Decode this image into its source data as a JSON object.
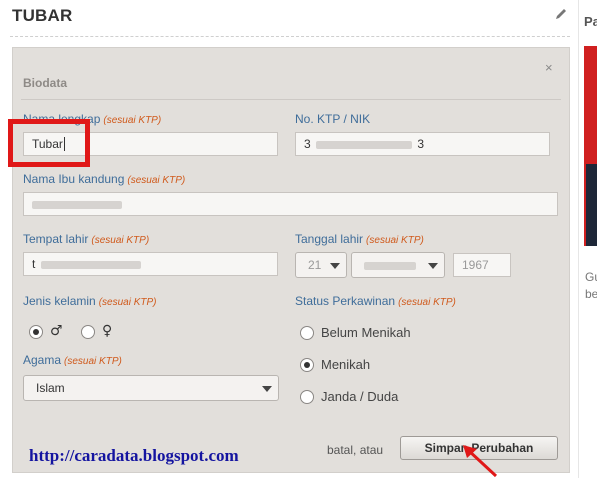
{
  "page": {
    "title": "TUBAR"
  },
  "sidebar": {
    "title": "Pa",
    "caption_line1": "Gu",
    "caption_line2": "be"
  },
  "form": {
    "section_title": "Biodata",
    "close_label": "×",
    "hint": "(sesuai KTP)",
    "full_name": {
      "label": "Nama lengkap",
      "value": "Tubar"
    },
    "ktp": {
      "label": "No. KTP / NIK",
      "value_start": "3",
      "value_end": "3"
    },
    "mother_name": {
      "label": "Nama Ibu kandung"
    },
    "birthplace": {
      "label": "Tempat lahir",
      "value_start": "t"
    },
    "birthdate": {
      "label": "Tanggal lahir",
      "day": "21",
      "year": "1967"
    },
    "gender": {
      "label": "Jenis kelamin",
      "options": [
        {
          "symbol": "♂",
          "checked": true
        },
        {
          "symbol": "♀",
          "checked": false
        }
      ]
    },
    "marital": {
      "label": "Status Perkawinan",
      "options": [
        {
          "label": "Belum Menikah",
          "checked": false
        },
        {
          "label": "Menikah",
          "checked": true
        },
        {
          "label": "Janda / Duda",
          "checked": false
        }
      ]
    },
    "religion": {
      "label": "Agama",
      "value": "Islam"
    },
    "cancel_text": "batal, atau",
    "save_label": "Simpan Perubahan",
    "blog_link": "http://caradata.blogspot.com"
  },
  "colors": {
    "highlight": "#e01818",
    "label": "#3f6d9a",
    "hint": "#d05a1c",
    "link": "#1414a0"
  }
}
